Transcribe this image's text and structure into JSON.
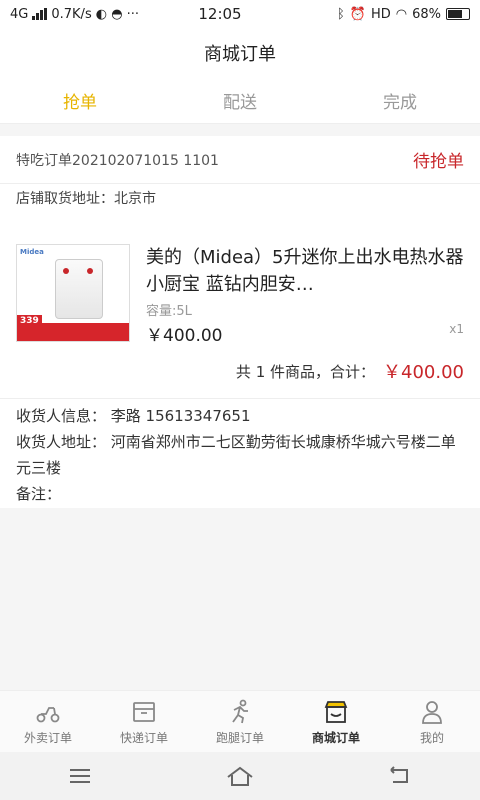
{
  "status_bar": {
    "network": "4G",
    "speed": "0.7K/s",
    "time": "12:05",
    "hd": "HD",
    "battery": "68%"
  },
  "header": {
    "title": "商城订单"
  },
  "tabs": [
    {
      "label": "抢单",
      "active": true
    },
    {
      "label": "配送",
      "active": false
    },
    {
      "label": "完成",
      "active": false
    }
  ],
  "order": {
    "id_label": "特吃订单202102071015 1101",
    "status": "待抢单",
    "pickup_label": "店铺取货地址：",
    "pickup_value": "北京市",
    "product": {
      "image_brand": "Midea",
      "image_price": "339",
      "name": "美的（Midea）5升迷你上出水电热水器小厨宝 蓝钻内胆安…",
      "spec": "容量:5L",
      "price": "￥400.00",
      "qty": "x1"
    },
    "summary_text": "共 1 件商品，合计：",
    "summary_total": "￥400.00",
    "receiver_info": "收货人信息：  李路  15613347651",
    "receiver_address": "收货人地址：  河南省郑州市二七区勤劳街长城康桥华城六号楼二单元三楼",
    "remark": "备注："
  },
  "bottom_nav": [
    {
      "label": "外卖订单",
      "icon": "scooter-icon",
      "active": false
    },
    {
      "label": "快递订单",
      "icon": "package-icon",
      "active": false
    },
    {
      "label": "跑腿订单",
      "icon": "runner-icon",
      "active": false
    },
    {
      "label": "商城订单",
      "icon": "shop-icon",
      "active": true
    },
    {
      "label": "我的",
      "icon": "user-icon",
      "active": false
    }
  ],
  "colors": {
    "accent": "#e7b400",
    "price": "#c8262a"
  }
}
